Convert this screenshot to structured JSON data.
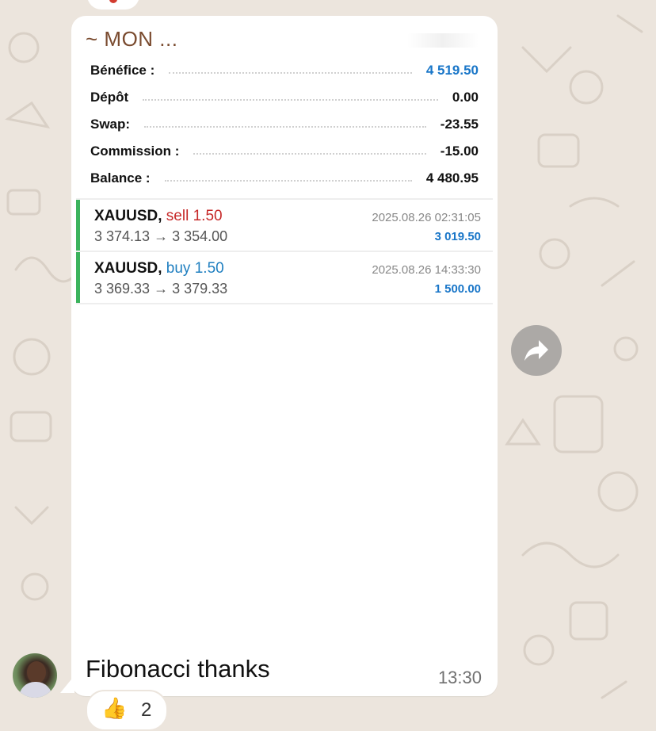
{
  "chat": {
    "sender_name": "~ MON ...",
    "message_text": "Fibonacci thanks",
    "time": "13:30",
    "reaction": {
      "emoji": "👍",
      "count": "2"
    }
  },
  "summary": [
    {
      "label": "Bénéfice :",
      "value": "4 519.50",
      "highlight": true
    },
    {
      "label": "Dépôt",
      "value": "0.00",
      "highlight": false
    },
    {
      "label": "Swap:",
      "value": "-23.55",
      "highlight": false
    },
    {
      "label": "Commission :",
      "value": "-15.00",
      "highlight": false
    },
    {
      "label": "Balance :",
      "value": "4 480.95",
      "highlight": false
    }
  ],
  "trades": [
    {
      "symbol": "XAUUSD,",
      "action": "sell",
      "volume": "1.50",
      "open_price": "3 374.13",
      "close_price": "3 354.00",
      "datetime": "2025.08.26 02:31:05",
      "profit": "3 019.50"
    },
    {
      "symbol": "XAUUSD,",
      "action": "buy",
      "volume": "1.50",
      "open_price": "3 369.33",
      "close_price": "3 379.33",
      "datetime": "2025.08.26 14:33:30",
      "profit": "1 500.00"
    }
  ],
  "icons": {
    "forward": "forward-arrow-icon",
    "reaction": "thumbs-up-icon",
    "avatar": "sender-avatar"
  },
  "colors": {
    "wallpaper": "#ece5dd",
    "bubble": "#ffffff",
    "profit_blue": "#1976c8",
    "sell_red": "#c62828",
    "buy_blue": "#1f7fc0",
    "trade_bar": "#3bb35c",
    "sender_name": "#7a4b2f"
  }
}
